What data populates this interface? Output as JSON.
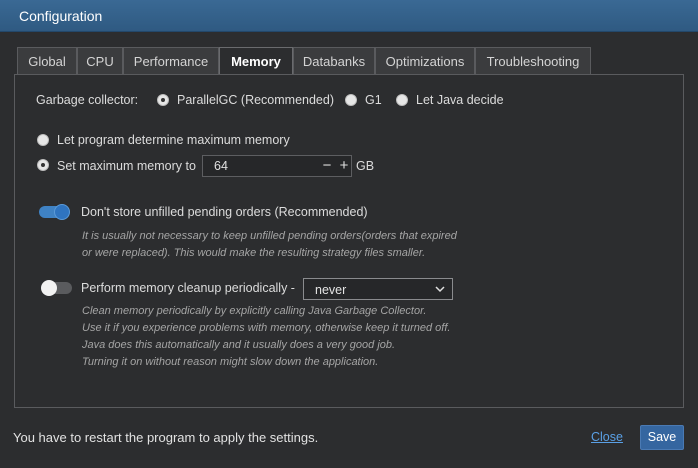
{
  "window": {
    "title": "Configuration"
  },
  "tabs": [
    {
      "label": "Global"
    },
    {
      "label": "CPU"
    },
    {
      "label": "Performance"
    },
    {
      "label": "Memory"
    },
    {
      "label": "Databanks"
    },
    {
      "label": "Optimizations"
    },
    {
      "label": "Troubleshooting"
    }
  ],
  "active_tab": "Memory",
  "memory": {
    "gc": {
      "label": "Garbage collector:",
      "options": [
        "ParallelGC (Recommended)",
        "G1",
        "Let Java decide"
      ],
      "selected": "ParallelGC (Recommended)"
    },
    "max_memory": {
      "option_auto": "Let program determine maximum memory",
      "option_set": "Set maximum memory to",
      "selected": "Set maximum memory to",
      "value": "64",
      "minus": "−",
      "plus": "+",
      "unit": "GB"
    },
    "pending_orders": {
      "label": "Don't store unfilled pending orders (Recommended)",
      "enabled": true,
      "desc": [
        "It is usually not necessary to keep unfilled pending orders(orders that expired",
        "or were replaced). This would make the resulting strategy files smaller."
      ]
    },
    "cleanup": {
      "label": "Perform memory cleanup periodically -",
      "enabled": false,
      "interval": "never",
      "desc": [
        "Clean memory periodically by explicitly calling Java Garbage Collector.",
        "Use it if you experience problems with memory, otherwise keep it turned off.",
        "Java does this automatically and it usually does a very good job.",
        "Turning it on without reason might slow down the application."
      ]
    }
  },
  "footer": {
    "message": "You have to restart the program to apply the settings.",
    "close_label": "Close",
    "save_label": "Save"
  },
  "colors": {
    "title_bar": "#3a6994",
    "background": "#2c2d2f",
    "toggle_on": "#3f82c4",
    "link": "#5aa0e6",
    "save_button": "#3566a0"
  }
}
